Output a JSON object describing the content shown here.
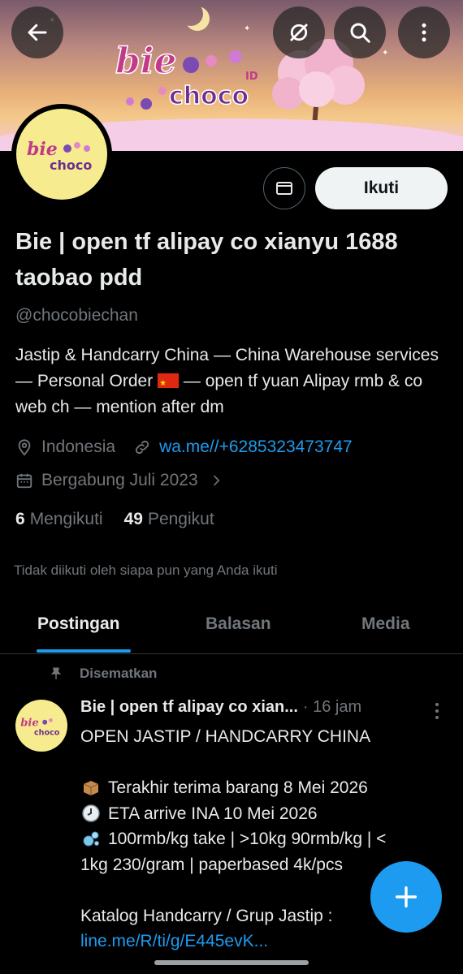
{
  "banner": {
    "logo_text_top": "bie",
    "logo_text_bottom": "choco",
    "logo_suffix": "ID"
  },
  "avatar": {
    "logo_text_top": "bie",
    "logo_text_bottom": "choco"
  },
  "profile": {
    "follow_label": "Ikuti",
    "name": "Bie | open tf alipay co xianyu 1688 taobao pdd",
    "handle": "@chocobiechan",
    "bio_part1": "Jastip & Handcarry China — China Warehouse services — Personal Order",
    "bio_part2": "— open tf yuan Alipay rmb & co web ch — mention after dm",
    "location": "Indonesia",
    "link": "wa.me//+6285323473747",
    "joined": "Bergabung Juli 2023",
    "following_count": "6",
    "following_label": "Mengikuti",
    "followers_count": "49",
    "followers_label": "Pengikut",
    "not_followed_text": "Tidak diikuti oleh siapa pun yang Anda ikuti"
  },
  "tabs": [
    {
      "label": "Postingan",
      "active": true
    },
    {
      "label": "Balasan",
      "active": false
    },
    {
      "label": "Media",
      "active": false
    }
  ],
  "post": {
    "pinned_label": "Disematkan",
    "author_name": "Bie | open tf alipay co xian...",
    "time": "· 16 jam",
    "line1": "OPEN JASTIP / HANDCARRY CHINA",
    "line2": "Terakhir terima barang 8 Mei 2026",
    "line3": "ETA arrive INA 10 Mei 2026",
    "line4": "100rmb/kg take | >10kg 90rmb/kg | <",
    "line5": "1kg 230/gram | paperbased 4k/pcs",
    "line6": "Katalog Handcarry / Grup Jastip :",
    "link": "line.me/R/ti/g/E445evK..."
  },
  "colors": {
    "accent": "#1d9bf0",
    "background": "#000000",
    "text": "#e7e9ea",
    "muted": "#71767b"
  }
}
